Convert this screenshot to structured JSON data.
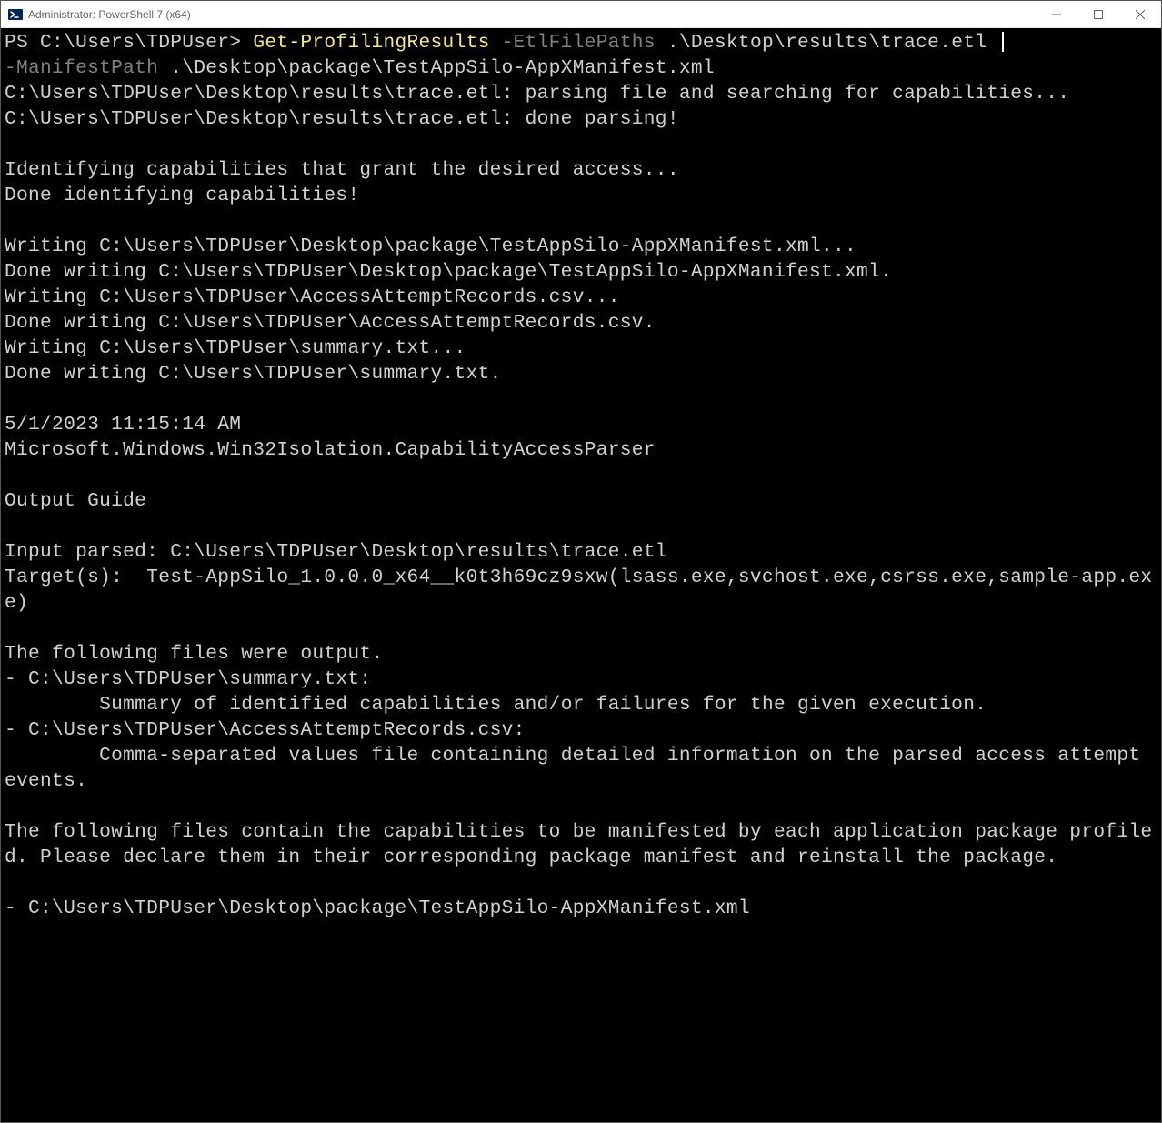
{
  "titlebar": {
    "title": "Administrator: PowerShell 7 (x64)"
  },
  "prompt": "PS C:\\Users\\TDPUser> ",
  "command": {
    "cmdlet": "Get-ProfilingResults",
    "param1_name": " -EtlFilePaths",
    "param1_value": " .\\Desktop\\results\\trace.etl ",
    "param2_name": "-ManifestPath",
    "param2_value": " .\\Desktop\\package\\TestAppSilo-AppXManifest.xml"
  },
  "output": {
    "l1": "C:\\Users\\TDPUser\\Desktop\\results\\trace.etl: parsing file and searching for capabilities...",
    "l2": "C:\\Users\\TDPUser\\Desktop\\results\\trace.etl: done parsing!",
    "l3": "",
    "l4": "Identifying capabilities that grant the desired access...",
    "l5": "Done identifying capabilities!",
    "l6": "",
    "l7": "Writing C:\\Users\\TDPUser\\Desktop\\package\\TestAppSilo-AppXManifest.xml...",
    "l8": "Done writing C:\\Users\\TDPUser\\Desktop\\package\\TestAppSilo-AppXManifest.xml.",
    "l9": "Writing C:\\Users\\TDPUser\\AccessAttemptRecords.csv...",
    "l10": "Done writing C:\\Users\\TDPUser\\AccessAttemptRecords.csv.",
    "l11": "Writing C:\\Users\\TDPUser\\summary.txt...",
    "l12": "Done writing C:\\Users\\TDPUser\\summary.txt.",
    "l13": "",
    "l14": "5/1/2023 11:15:14 AM",
    "l15": "Microsoft.Windows.Win32Isolation.CapabilityAccessParser",
    "l16": "",
    "l17": "Output Guide",
    "l18": "",
    "l19": "Input parsed: C:\\Users\\TDPUser\\Desktop\\results\\trace.etl",
    "l20": "Target(s):  Test-AppSilo_1.0.0.0_x64__k0t3h69cz9sxw(lsass.exe,svchost.exe,csrss.exe,sample-app.exe)",
    "l21": "",
    "l22": "The following files were output.",
    "l23": "- C:\\Users\\TDPUser\\summary.txt:",
    "l24": "        Summary of identified capabilities and/or failures for the given execution.",
    "l25": "- C:\\Users\\TDPUser\\AccessAttemptRecords.csv:",
    "l26": "        Comma-separated values file containing detailed information on the parsed access attempt events.",
    "l27": "",
    "l28": "The following files contain the capabilities to be manifested by each application package profiled. Please declare them in their corresponding package manifest and reinstall the package.",
    "l29": "",
    "l30": "- C:\\Users\\TDPUser\\Desktop\\package\\TestAppSilo-AppXManifest.xml"
  }
}
